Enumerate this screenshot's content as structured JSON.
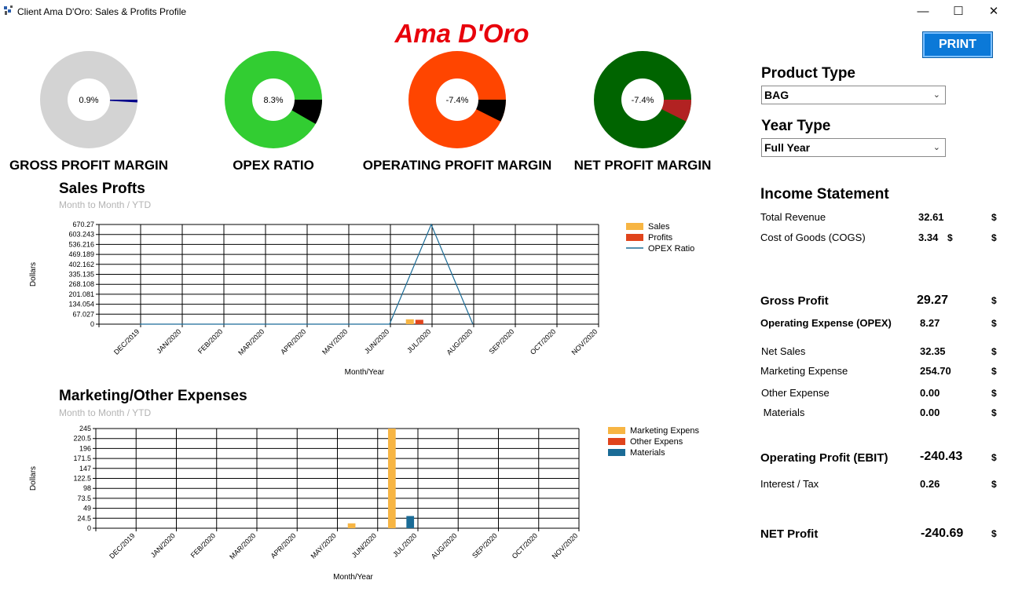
{
  "window": {
    "title": "Client Ama D'Oro:  Sales & Profits Profile",
    "minimize": "—",
    "maximize": "☐",
    "close": "✕"
  },
  "brand": "Ama D'Oro",
  "print_label": "PRINT",
  "kpis": [
    {
      "label": "GROSS PROFIT MARGIN",
      "value_text": "0.9%",
      "percent": 0.9,
      "color": "#d3d3d3",
      "slice_color": "#00008b"
    },
    {
      "label": "OPEX RATIO",
      "value_text": "8.3%",
      "percent": 8.3,
      "color": "#32cd32",
      "slice_color": "#000000"
    },
    {
      "label": "OPERATING PROFIT MARGIN",
      "value_text": "-7.4%",
      "percent": 7.4,
      "color": "#ff4500",
      "slice_color": "#000000"
    },
    {
      "label": "NET PROFIT MARGIN",
      "value_text": "-7.4%",
      "percent": 7.4,
      "color": "#006400",
      "slice_color": "#b22222"
    }
  ],
  "filters": {
    "product_type_label": "Product Type",
    "product_type_value": "BAG",
    "year_type_label": "Year  Type",
    "year_type_value": "Full Year"
  },
  "income_statement": {
    "title": "Income Statement",
    "rows": [
      {
        "label": "Total Revenue",
        "value": "32.61",
        "currency": "$"
      },
      {
        "label": "Cost of Goods (COGS)",
        "value": "3.34",
        "inline_currency": "$",
        "currency": "$"
      },
      {
        "label": "Gross Profit",
        "value": "29.27",
        "currency": "$"
      },
      {
        "label": "Operating Expense (OPEX)",
        "value": "8.27",
        "currency": "$"
      },
      {
        "label": "Net Sales",
        "value": "32.35",
        "currency": "$"
      },
      {
        "label": "Marketing Expense",
        "value": "254.70",
        "currency": "$"
      },
      {
        "label": "Other Expense",
        "value": "0.00",
        "currency": "$"
      },
      {
        "label": " Materials",
        "value": "0.00",
        "currency": "$"
      },
      {
        "label": "Operating Profit (EBIT)",
        "value": "-240.43",
        "currency": "$"
      },
      {
        "label": "Interest / Tax",
        "value": "0.26",
        "currency": "$"
      },
      {
        "label": "NET Profit",
        "value": "-240.69",
        "currency": "$"
      }
    ]
  },
  "chart_data": [
    {
      "type": "bar",
      "title": "Sales Profts",
      "subtitle": "Month to Month / YTD",
      "title_color": "#1e6fb5",
      "xlabel": "Month/Year",
      "ylabel": "Dollars",
      "ylim": [
        0,
        670.27
      ],
      "yticks": [
        "0",
        "67.027",
        "134.054",
        "201.081",
        "268.108",
        "335.135",
        "402.162",
        "469.189",
        "536.216",
        "603.243",
        "670.27"
      ],
      "categories": [
        "DEC/2019",
        "JAN/2020",
        "FEB/2020",
        "MAR/2020",
        "APR/2020",
        "MAY/2020",
        "JUN/2020",
        "JUL/2020",
        "AUG/2020",
        "SEP/2020",
        "OCT/2020",
        "NOV/2020"
      ],
      "series": [
        {
          "name": "Sales",
          "kind": "bar",
          "color": "#f7b543",
          "values": [
            0,
            0,
            0,
            0,
            0,
            0,
            0,
            32.61,
            0,
            0,
            0,
            0
          ]
        },
        {
          "name": "Profits",
          "kind": "bar",
          "color": "#e0441c",
          "values": [
            0,
            0,
            0,
            0,
            0,
            0,
            0,
            29.27,
            0,
            0,
            0,
            0
          ]
        },
        {
          "name": "OPEX Ratio",
          "kind": "line",
          "color": "#1a6b96",
          "values": [
            0,
            0,
            0,
            0,
            0,
            0,
            0,
            670.27,
            0,
            null,
            null,
            null
          ]
        }
      ],
      "legend_position": "right",
      "grid": true
    },
    {
      "type": "bar",
      "title": "Marketing/Other Expenses",
      "subtitle": "Month to Month / YTD",
      "title_color": "#f5a623",
      "xlabel": "Month/Year",
      "ylabel": "Dollars",
      "ylim": [
        0,
        245
      ],
      "yticks": [
        "0",
        "24.5",
        "49",
        "73.5",
        "98",
        "122.5",
        "147",
        "171.5",
        "196",
        "220.5",
        "245"
      ],
      "categories": [
        "DEC/2019",
        "JAN/2020",
        "FEB/2020",
        "MAR/2020",
        "APR/2020",
        "MAY/2020",
        "JUN/2020",
        "JUL/2020",
        "AUG/2020",
        "SEP/2020",
        "OCT/2020",
        "NOV/2020"
      ],
      "series": [
        {
          "name": "Marketing Expens",
          "kind": "bar",
          "color": "#f7b543",
          "values": [
            0,
            0,
            0,
            0,
            0,
            0,
            12,
            245,
            0,
            0,
            0,
            0
          ]
        },
        {
          "name": "Other Expens",
          "kind": "bar",
          "color": "#e0441c",
          "values": [
            0,
            0,
            0,
            0,
            0,
            0,
            0,
            0,
            0,
            0,
            0,
            0
          ]
        },
        {
          "name": "Materials",
          "kind": "bar",
          "color": "#1a6b96",
          "values": [
            0,
            0,
            0,
            0,
            0,
            0,
            0,
            30,
            0,
            0,
            0,
            0
          ]
        }
      ],
      "legend_position": "right",
      "grid": true
    }
  ]
}
